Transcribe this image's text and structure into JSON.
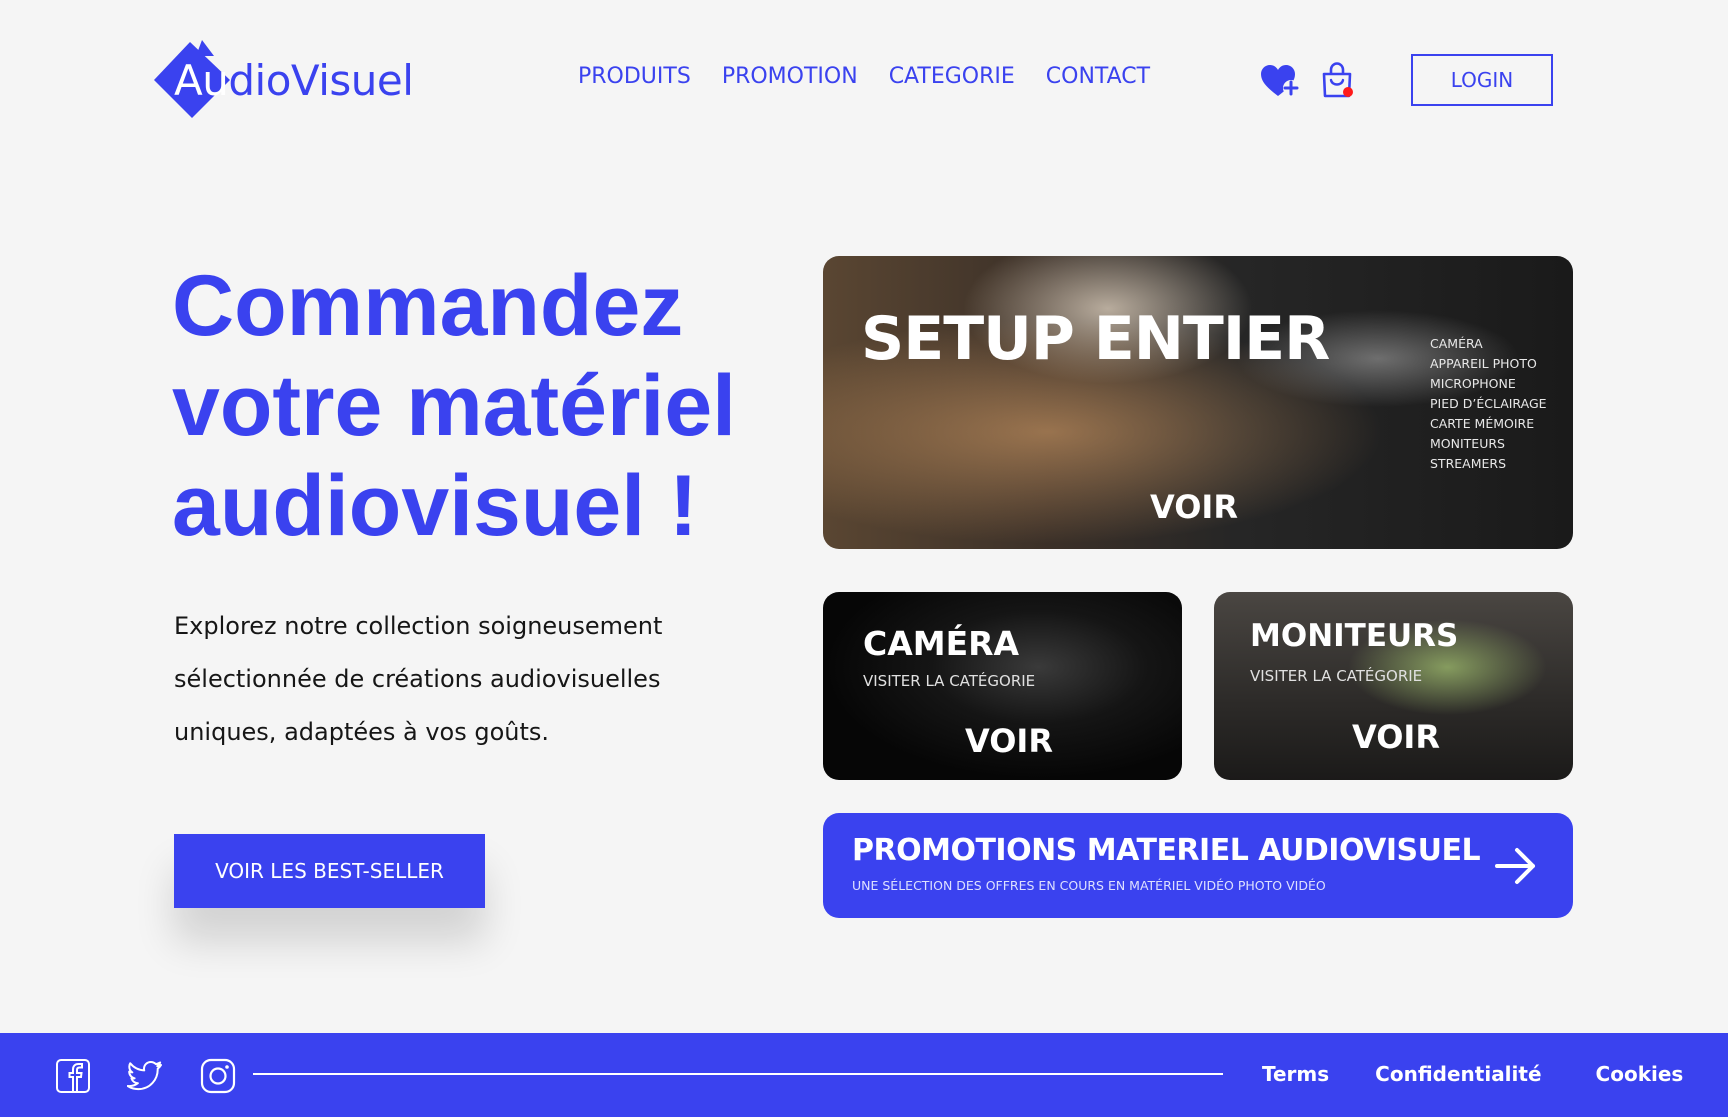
{
  "brand": {
    "logo_first": "Au",
    "logo_rest": "dioVisuel",
    "accent": "#3a42ef"
  },
  "nav": {
    "items": [
      "PRODUITS",
      "PROMOTION",
      "CATEGORIE",
      "CONTACT"
    ]
  },
  "header": {
    "wishlist_icon": "heart-plus-icon",
    "cart_icon": "shopping-bag-icon",
    "cart_badge_color": "#ff1a1a",
    "login_label": "LOGIN"
  },
  "hero": {
    "title": "Commandez\nvotre matériel\naudiovisuel !",
    "description": "Explorez notre collection soigneusement sélectionnée de créations audiovisuelles uniques, adaptées à vos goûts.",
    "cta_label": "VOIR LES BEST-SELLER"
  },
  "cards": {
    "setup": {
      "title": "SETUP ENTIER",
      "items": [
        "CAMÉRA",
        "APPAREIL PHOTO",
        "MICROPHONE",
        "PIED D’ÉCLAIRAGE",
        "CARTE MÉMOIRE",
        "MONITEURS",
        "STREAMERS"
      ],
      "voir": "VOIR"
    },
    "camera": {
      "title": "CAMÉRA",
      "subtitle": "VISITER LA CATÉGORIE",
      "voir": "VOIR"
    },
    "monitors": {
      "title": "MONITEURS",
      "subtitle": "VISITER LA CATÉGORIE",
      "voir": "VOIR"
    }
  },
  "promo": {
    "title": "PROMOTIONS MATERIEL AUDIOVISUEL",
    "subtitle": "UNE SÉLECTION DES OFFRES EN COURS EN MATÉRIEL VIDÉO PHOTO VIDÉO",
    "arrow_icon": "arrow-right-icon"
  },
  "footer": {
    "social": [
      "facebook-icon",
      "twitter-icon",
      "instagram-icon"
    ],
    "links": [
      "Terms",
      "Confidentialité",
      "Cookies"
    ]
  }
}
